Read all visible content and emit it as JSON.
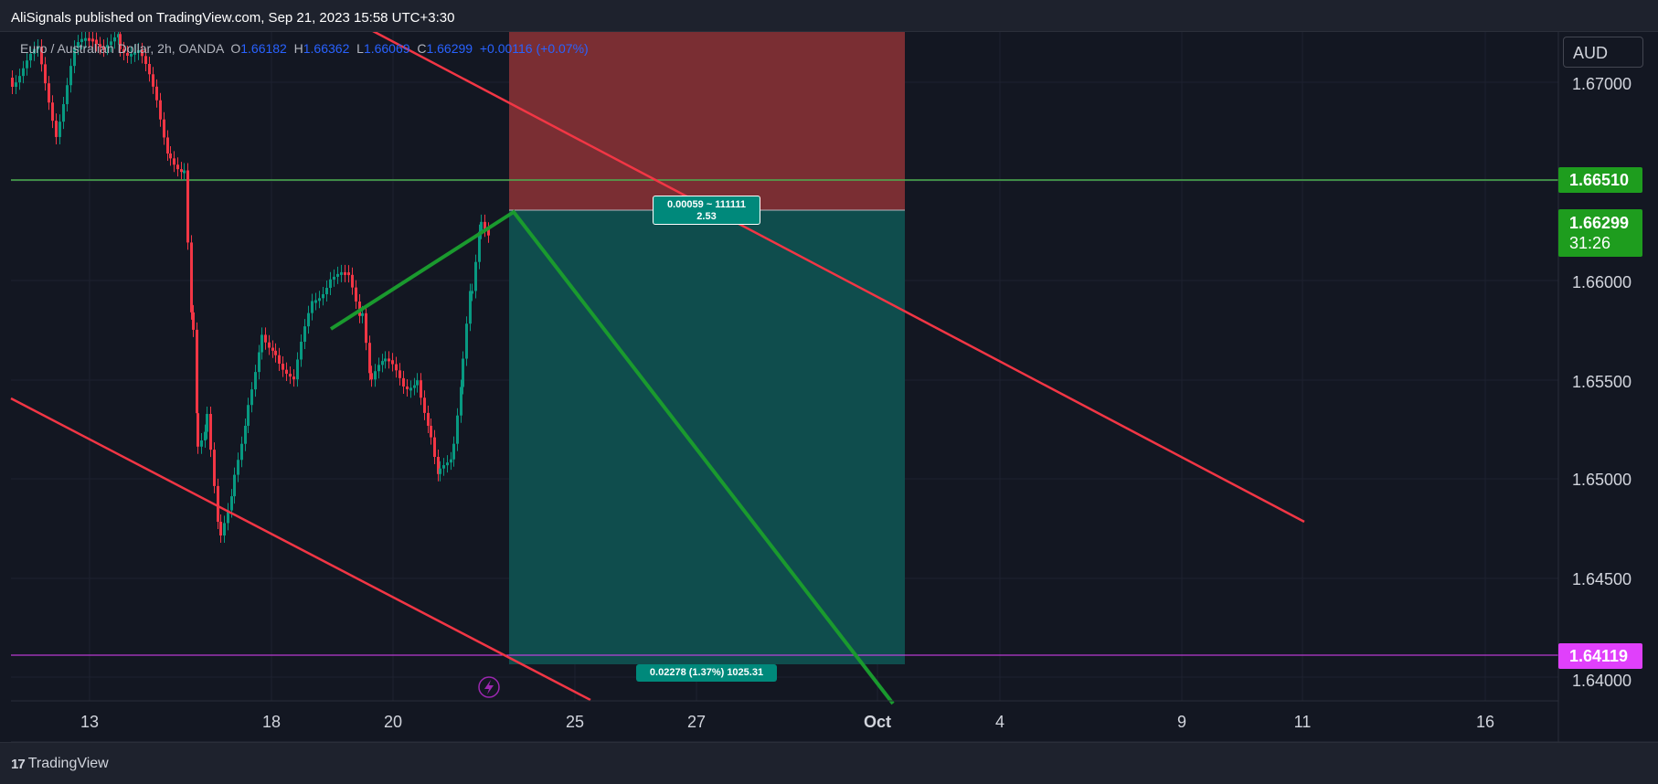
{
  "publisher": "AliSignals published on TradingView.com, Sep 21, 2023 15:58 UTC+3:30",
  "legend": {
    "symbol": "Euro / Australian Dollar, 2h, OANDA",
    "open_label": "O",
    "open": "1.66182",
    "high_label": "H",
    "high": "1.66362",
    "low_label": "L",
    "low": "1.66069",
    "close_label": "C",
    "close": "1.66299",
    "change": "+0.00116 (+0.07%)"
  },
  "currency": "AUD",
  "price_axis": {
    "ticks": [
      "1.67000",
      "1.66000",
      "1.65500",
      "1.65000",
      "1.64500",
      "1.64000"
    ],
    "tag_green": "1.66510",
    "tag_current": "1.66299",
    "tag_countdown": "31:26",
    "tag_magenta": "1.64119"
  },
  "time_axis": {
    "ticks": [
      "13",
      "18",
      "20",
      "25",
      "27",
      "Oct",
      "4",
      "9",
      "11",
      "16"
    ]
  },
  "position": {
    "risk_label_1": "0.00059 ~ 111111",
    "risk_label_2": "2.53",
    "target_label": "0.02278 (1.37%) 1025.31"
  },
  "colors": {
    "background": "#131722",
    "up": "#089981",
    "down": "#f23645",
    "trend_line": "#f23645",
    "projection": "#1a9a2e",
    "resistance": "#4caf50",
    "target_line": "#e040fb",
    "stop_zone": "#7a2e33",
    "profit_zone": "#0f4d4d"
  },
  "footer": {
    "logo_text": "TradingView"
  }
}
